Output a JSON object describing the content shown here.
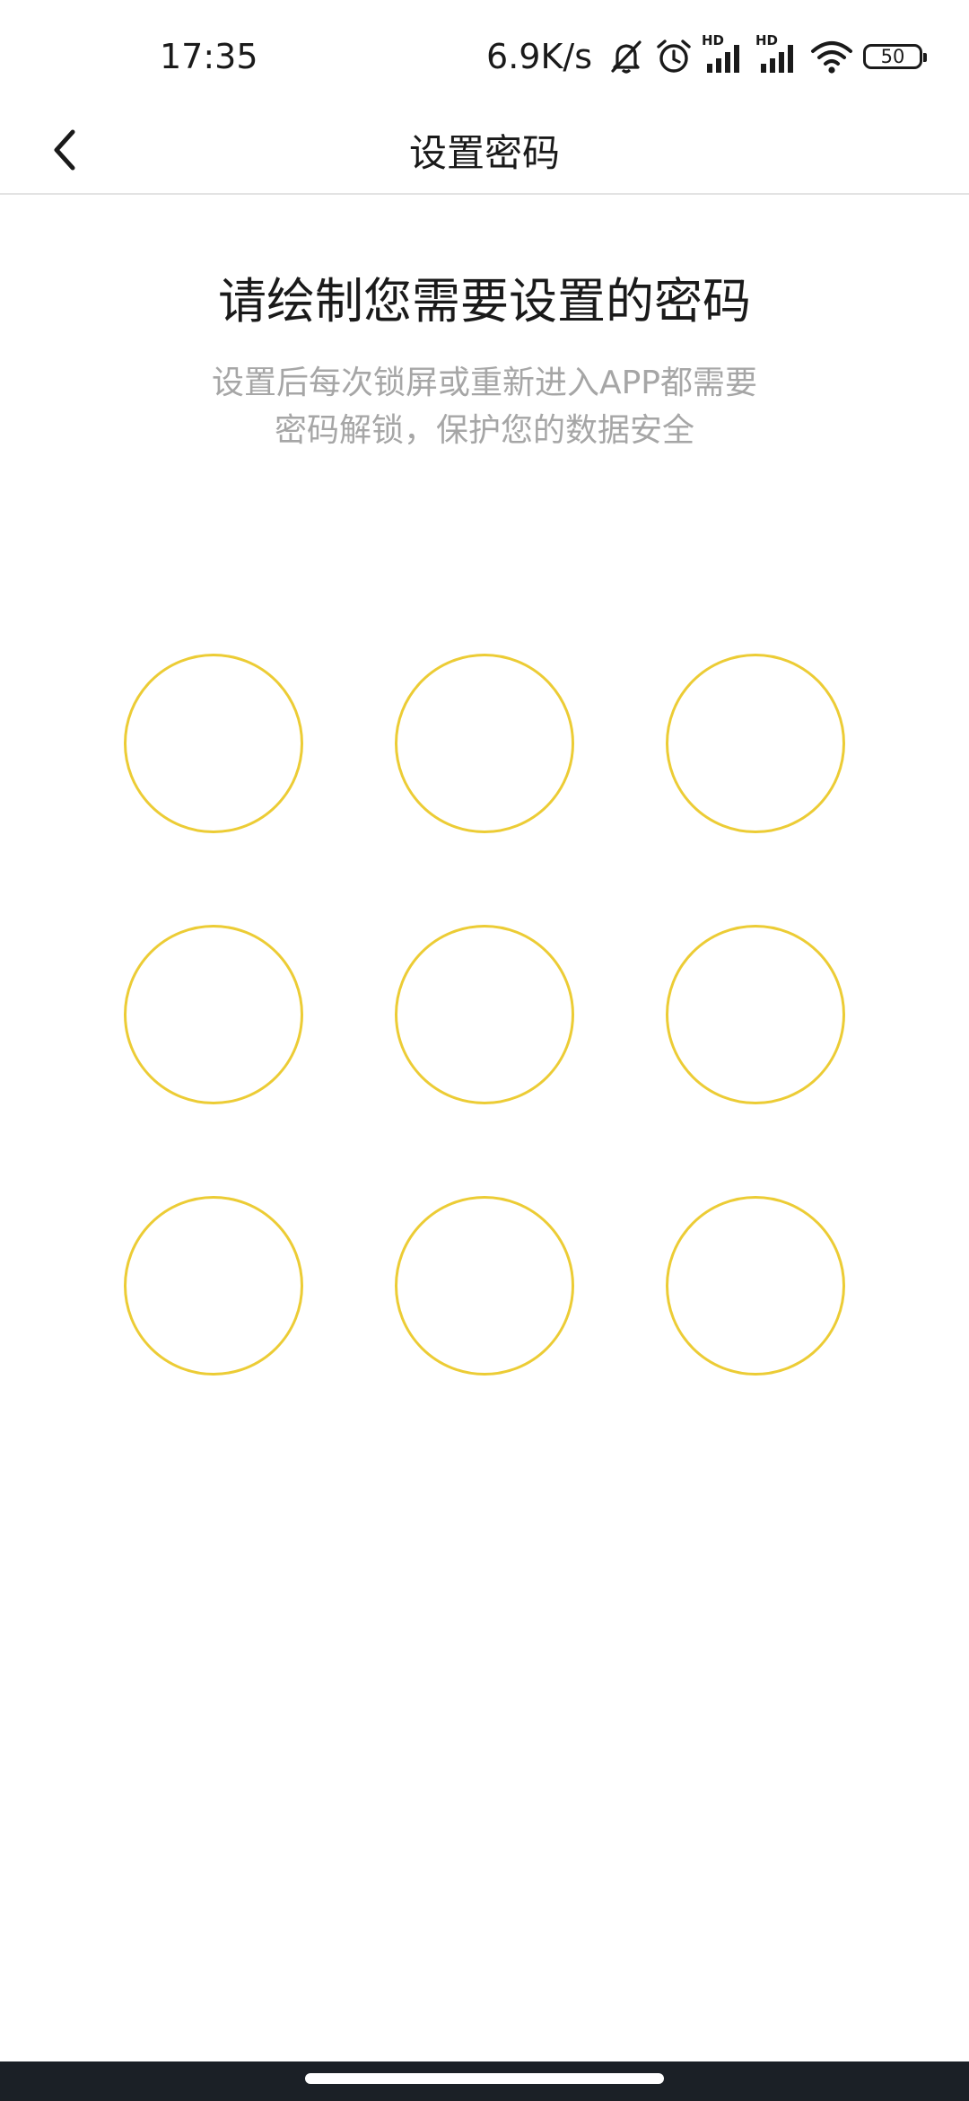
{
  "status_bar": {
    "time": "17:35",
    "net_speed": "6.9K/s",
    "battery": "50",
    "signal_1_label": "HD",
    "signal_2_label": "HD",
    "icons": [
      "mute-bell-icon",
      "alarm-icon",
      "signal-icon",
      "signal-icon",
      "wifi-icon",
      "battery-icon"
    ]
  },
  "nav": {
    "title": "设置密码",
    "back_icon": "chevron-left-icon"
  },
  "content": {
    "heading": "请绘制您需要设置的密码",
    "subtitle_line1": "设置后每次锁屏或重新进入APP都需要",
    "subtitle_line2": "密码解锁，保护您的数据安全"
  },
  "pattern": {
    "rows": 3,
    "cols": 3,
    "ring_color": "#eccc35"
  },
  "colors": {
    "accent": "#eccc35",
    "subtitle": "#a6a6a6",
    "text": "#1a1a1a"
  }
}
